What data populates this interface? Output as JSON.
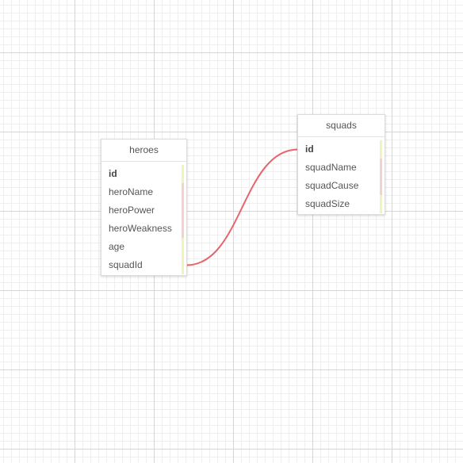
{
  "colors": {
    "relation_line": "#e8636b",
    "marker_key": "#eef5b6",
    "marker_attr": "#f8cfcf"
  },
  "tables": [
    {
      "name": "heroes",
      "fields": [
        {
          "name": "id",
          "primary": true,
          "marker": "key"
        },
        {
          "name": "heroName",
          "primary": false,
          "marker": "attr"
        },
        {
          "name": "heroPower",
          "primary": false,
          "marker": "attr"
        },
        {
          "name": "heroWeakness",
          "primary": false,
          "marker": "attr"
        },
        {
          "name": "age",
          "primary": false,
          "marker": "key"
        },
        {
          "name": "squadId",
          "primary": false,
          "marker": "key"
        }
      ]
    },
    {
      "name": "squads",
      "fields": [
        {
          "name": "id",
          "primary": true,
          "marker": "key"
        },
        {
          "name": "squadName",
          "primary": false,
          "marker": "attr"
        },
        {
          "name": "squadCause",
          "primary": false,
          "marker": "attr"
        },
        {
          "name": "squadSize",
          "primary": false,
          "marker": "key"
        }
      ]
    }
  ],
  "relations": [
    {
      "from_table": "heroes",
      "from_field": "squadId",
      "to_table": "squads",
      "to_field": "id"
    }
  ]
}
